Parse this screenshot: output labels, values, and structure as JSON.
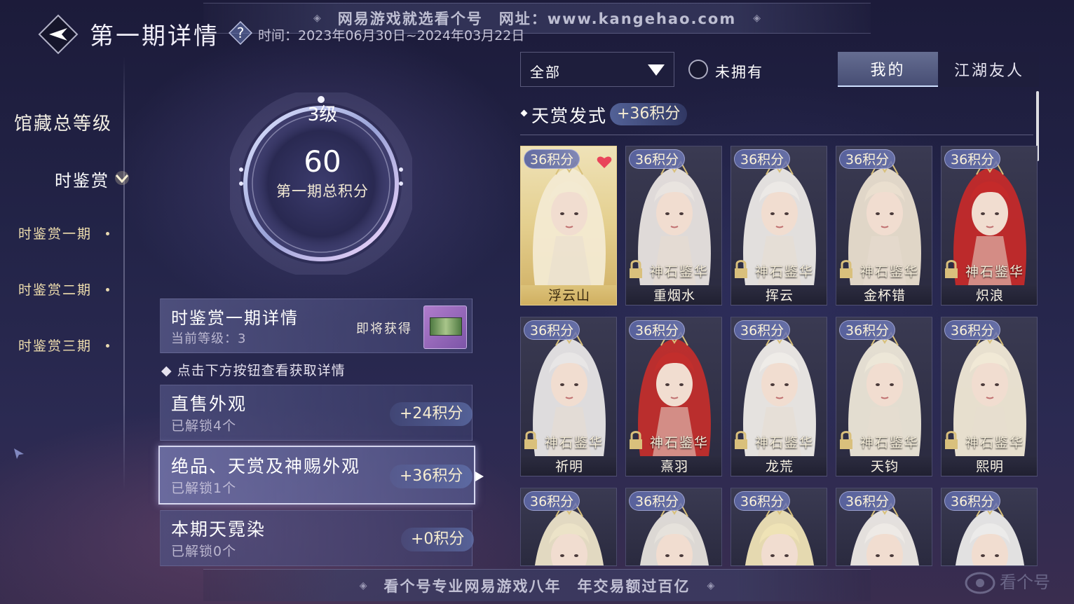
{
  "banners": {
    "top": "网易游戏就选看个号　网址：www.kangehao.com",
    "bottom": "看个号专业网易游戏八年　年交易额过百亿"
  },
  "header": {
    "title": "第一期详情",
    "time": "时间：2023年06月30日~2024年03月22日"
  },
  "nav": {
    "main": "馆藏总等级",
    "active_sub": "时鉴赏",
    "periods": [
      "时鉴赏一期",
      "时鉴赏二期",
      "时鉴赏三期"
    ]
  },
  "summary": {
    "level": "3级",
    "score": "60",
    "score_label": "第一期总积分"
  },
  "details": {
    "title": "时鉴赏一期详情",
    "current_level": "当前等级：3",
    "soon_label": "即将获得"
  },
  "hint": "点击下方按钮查看获取详情",
  "categories": [
    {
      "title": "直售外观",
      "sub": "已解锁4个",
      "pts": "+24积分"
    },
    {
      "title": "绝品、天赏及神赐外观",
      "sub": "已解锁1个",
      "pts": "+36积分"
    },
    {
      "title": "本期天霓染",
      "sub": "已解锁0个",
      "pts": "+0积分"
    }
  ],
  "filters": {
    "dropdown": "全部",
    "unowned": "未拥有",
    "tabs": [
      "我的",
      "江湖友人"
    ]
  },
  "section": {
    "title": "天赏发式",
    "pts": "+36积分"
  },
  "cards": [
    {
      "pts": "36积分",
      "tag": "",
      "name": "浮云山",
      "owned": true
    },
    {
      "pts": "36积分",
      "tag": "神石鉴华",
      "name": "重烟水",
      "owned": false
    },
    {
      "pts": "36积分",
      "tag": "神石鉴华",
      "name": "挥云",
      "owned": false
    },
    {
      "pts": "36积分",
      "tag": "神石鉴华",
      "name": "金杯错",
      "owned": false
    },
    {
      "pts": "36积分",
      "tag": "神石鉴华",
      "name": "炽浪",
      "owned": false
    },
    {
      "pts": "36积分",
      "tag": "神石鉴华",
      "name": "祈明",
      "owned": false
    },
    {
      "pts": "36积分",
      "tag": "神石鉴华",
      "name": "熹羽",
      "owned": false
    },
    {
      "pts": "36积分",
      "tag": "神石鉴华",
      "name": "龙荒",
      "owned": false
    },
    {
      "pts": "36积分",
      "tag": "神石鉴华",
      "name": "天钧",
      "owned": false
    },
    {
      "pts": "36积分",
      "tag": "神石鉴华",
      "name": "熙明",
      "owned": false
    },
    {
      "pts": "36积分",
      "tag": "",
      "name": "",
      "owned": false
    },
    {
      "pts": "36积分",
      "tag": "",
      "name": "",
      "owned": false
    },
    {
      "pts": "36积分",
      "tag": "",
      "name": "",
      "owned": false
    },
    {
      "pts": "36积分",
      "tag": "",
      "name": "",
      "owned": false
    },
    {
      "pts": "36积分",
      "tag": "",
      "name": "",
      "owned": false
    }
  ],
  "colors": {
    "accent_gold": "#e8d08e",
    "points_text": "#f6ecd0"
  }
}
